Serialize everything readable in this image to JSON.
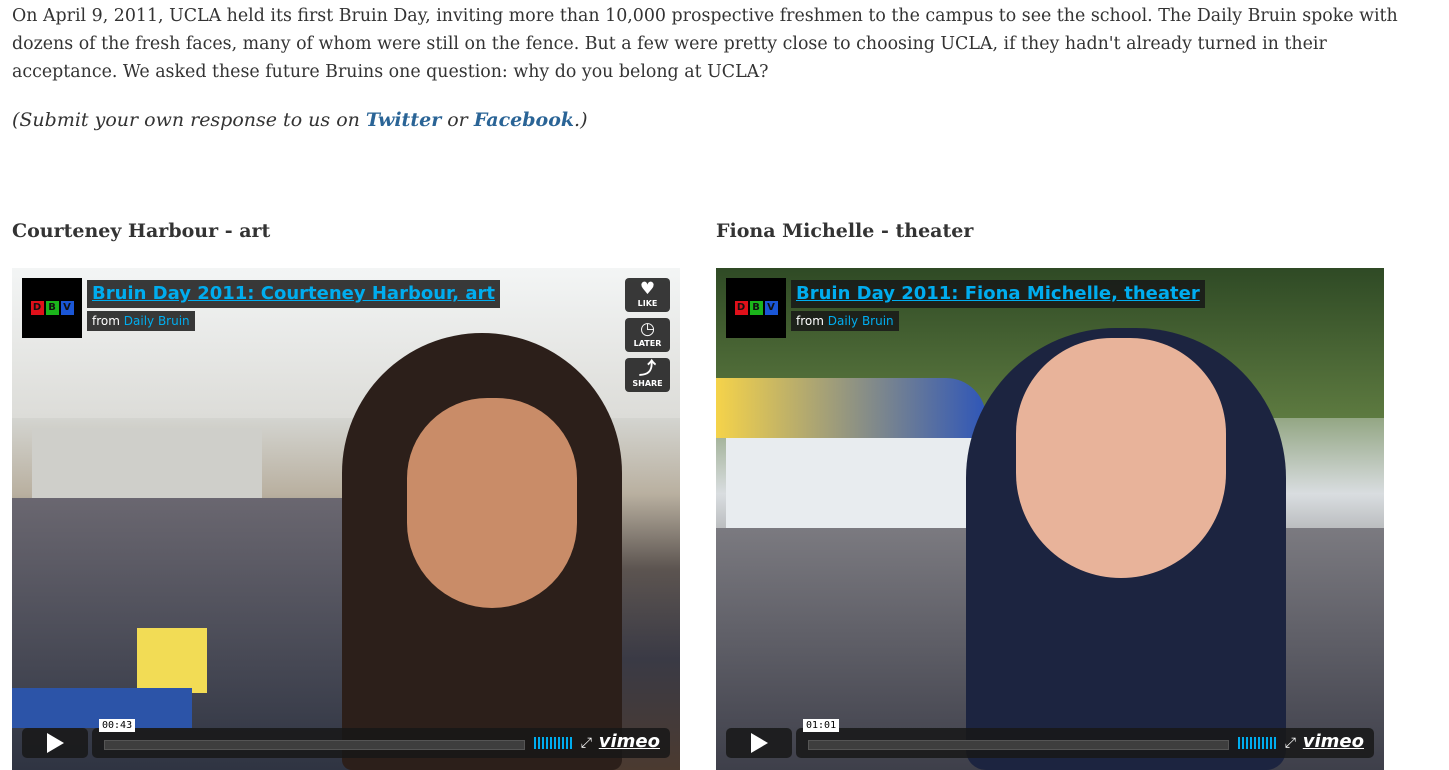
{
  "article": {
    "intro": "On April 9, 2011, UCLA held its first Bruin Day, inviting more than 10,000 prospective freshmen to the campus to see the school. The Daily Bruin spoke with dozens of the fresh faces, many of whom were still on the fence. But a few were pretty close to choosing UCLA, if they hadn't already turned in their acceptance. We asked these future Bruins one question: why do you belong at UCLA?",
    "submit_prefix": "(Submit your own response to us on ",
    "twitter_link": "Twitter",
    "submit_or": " or ",
    "facebook_link": "Facebook",
    "submit_suffix": ".)"
  },
  "videos": [
    {
      "caption": "Courteney Harbour - art",
      "title": "Bruin Day 2011: Courteney Harbour, art",
      "from_label": "from",
      "channel": "Daily Bruin",
      "time": "00:43",
      "brand": "vimeo",
      "buttons": {
        "like": "LIKE",
        "later": "LATER",
        "share": "SHARE"
      }
    },
    {
      "caption": "Fiona Michelle - theater",
      "title": "Bruin Day 2011: Fiona Michelle, theater",
      "from_label": "from",
      "channel": "Daily Bruin",
      "time": "01:01",
      "brand": "vimeo"
    }
  ],
  "logo": {
    "letters": [
      "D",
      "B",
      "V"
    ],
    "colors": [
      "#e0101a",
      "#1bb51b",
      "#1a56d6"
    ]
  },
  "colors": {
    "link": "#2a6496",
    "vimeo_accent": "#00adef",
    "overlay": "#171717"
  },
  "icons": {
    "like": "heart-icon",
    "later": "clock-icon",
    "share": "share-icon",
    "play": "play-icon",
    "fullscreen": "fullscreen-icon"
  }
}
